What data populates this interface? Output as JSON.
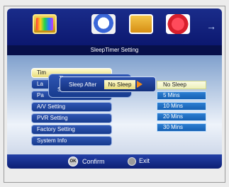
{
  "header": {
    "icons": [
      "tv-icon",
      "search-icon",
      "film-icon",
      "heart-icon"
    ],
    "next_arrow": "→",
    "title": "SleepTimer Setting"
  },
  "menu": {
    "items": [
      {
        "label": "Tim"
      },
      {
        "label": "La"
      },
      {
        "label": "Pa"
      },
      {
        "label": "A/V Setting"
      },
      {
        "label": "PVR Setting"
      },
      {
        "label": "Factory Setting"
      },
      {
        "label": "System Info"
      }
    ]
  },
  "submenu": {
    "label1": "Ti",
    "label2": "S"
  },
  "sleep_popup": {
    "label": "Sleep After",
    "value": "No Sleep"
  },
  "options": [
    "No Sleep",
    "5 Mins",
    "10 Mins",
    "20 Mins",
    "30 Mins"
  ],
  "footer": {
    "ok_badge": "OK",
    "confirm": "Confirm",
    "exit": "Exit"
  }
}
